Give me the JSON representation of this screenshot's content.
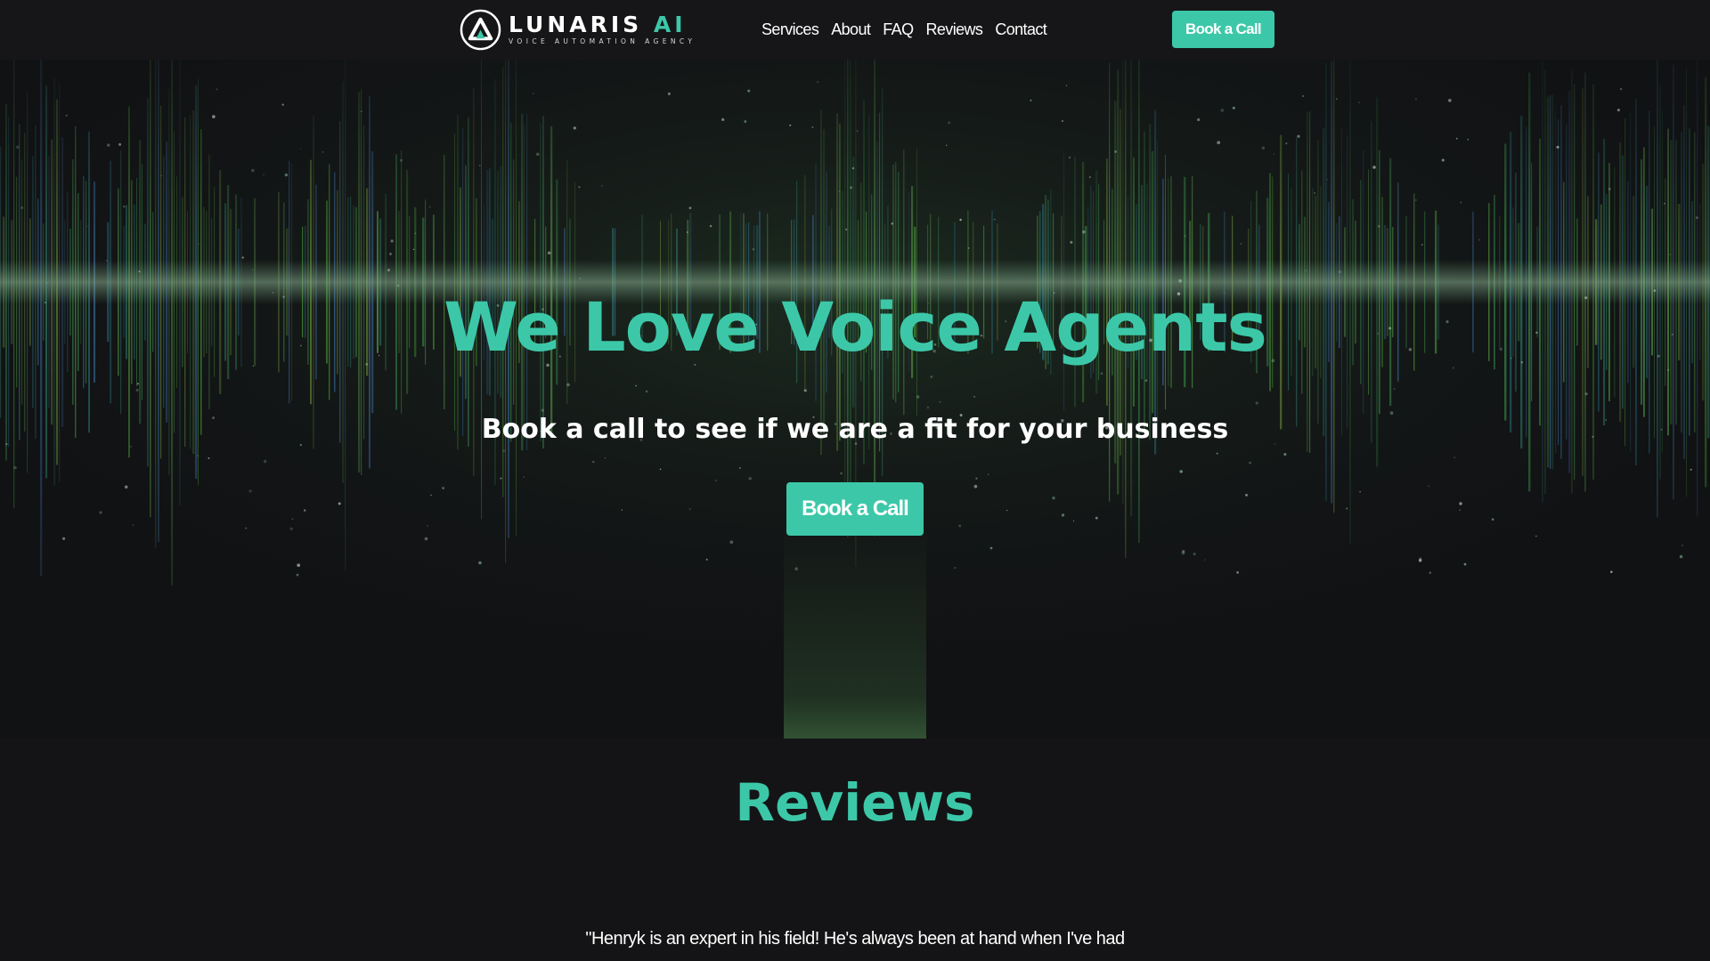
{
  "header": {
    "logo_name_main": "LUNARIS",
    "logo_name_accent": "AI",
    "logo_tagline": "VOICE AUTOMATION AGENCY",
    "nav": [
      "Services",
      "About",
      "FAQ",
      "Reviews",
      "Contact"
    ],
    "cta_label": "Book a Call"
  },
  "hero": {
    "title": "We Love Voice Agents",
    "subtitle": "Book a call to see if we are a fit for your business",
    "cta_label": "Book a Call"
  },
  "reviews": {
    "title": "Reviews",
    "quote_partial": "\"Henryk is an expert in his field! He's always been at hand when I've had"
  },
  "colors": {
    "accent": "#3cc8a8",
    "background": "#131315",
    "header_bg": "#161618"
  }
}
